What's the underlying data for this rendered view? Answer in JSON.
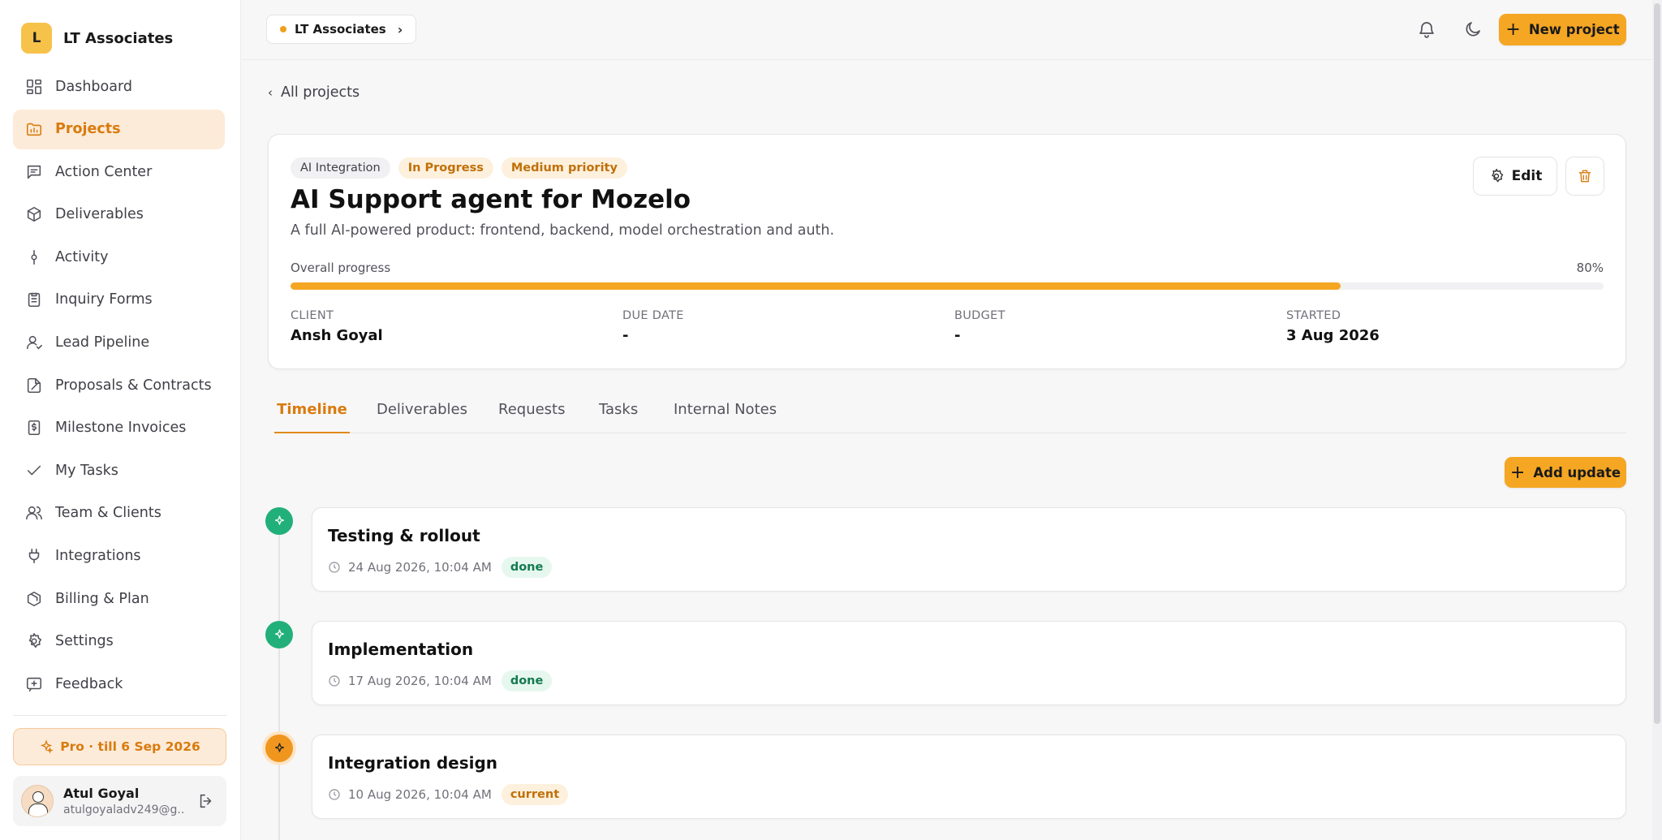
{
  "brand": {
    "logo_letter": "L",
    "name": "LT Associates"
  },
  "sidebar": {
    "items": [
      {
        "label": "Dashboard",
        "icon": "dashboard-icon",
        "active": false
      },
      {
        "label": "Projects",
        "icon": "projects-icon",
        "active": true
      },
      {
        "label": "Action Center",
        "icon": "action-center-icon",
        "active": false
      },
      {
        "label": "Deliverables",
        "icon": "deliverables-icon",
        "active": false
      },
      {
        "label": "Activity",
        "icon": "activity-icon",
        "active": false
      },
      {
        "label": "Inquiry Forms",
        "icon": "clipboard-icon",
        "active": false
      },
      {
        "label": "Lead Pipeline",
        "icon": "lead-icon",
        "active": false
      },
      {
        "label": "Proposals & Contracts",
        "icon": "contract-icon",
        "active": false
      },
      {
        "label": "Milestone Invoices",
        "icon": "invoice-icon",
        "active": false
      },
      {
        "label": "My Tasks",
        "icon": "check-icon",
        "active": false
      },
      {
        "label": "Team & Clients",
        "icon": "users-icon",
        "active": false
      },
      {
        "label": "Integrations",
        "icon": "plug-icon",
        "active": false
      },
      {
        "label": "Billing & Plan",
        "icon": "billing-icon",
        "active": false
      },
      {
        "label": "Settings",
        "icon": "gear-icon",
        "active": false
      },
      {
        "label": "Feedback",
        "icon": "feedback-icon",
        "active": false
      }
    ],
    "plan_label": "Pro · till 6 Sep 2026",
    "user": {
      "name": "Atul Goyal",
      "email": "atulgoyaladv249@g..."
    }
  },
  "topbar": {
    "workspace": "LT Associates",
    "new_project_label": "New project"
  },
  "main": {
    "back_label": "All projects",
    "project": {
      "tags": [
        {
          "label": "AI Integration",
          "style": "gray"
        },
        {
          "label": "In Progress",
          "style": "orange"
        },
        {
          "label": "Medium priority",
          "style": "orange"
        }
      ],
      "title": "AI Support agent for Mozelo",
      "description": "A full AI-powered product: frontend, backend, model orchestration and auth.",
      "edit_label": "Edit",
      "progress_label": "Overall progress",
      "progress_percent": 80,
      "progress_text": "80%",
      "meta": [
        {
          "label": "CLIENT",
          "value": "Ansh Goyal"
        },
        {
          "label": "DUE DATE",
          "value": "-"
        },
        {
          "label": "BUDGET",
          "value": "-"
        },
        {
          "label": "STARTED",
          "value": "3 Aug 2026"
        }
      ]
    },
    "tabs": [
      {
        "label": "Timeline",
        "active": true
      },
      {
        "label": "Deliverables",
        "active": false
      },
      {
        "label": "Requests",
        "active": false
      },
      {
        "label": "Tasks",
        "active": false
      },
      {
        "label": "Internal Notes",
        "active": false
      }
    ],
    "add_update_label": "Add update",
    "timeline": [
      {
        "title": "Testing & rollout",
        "time": "24 Aug 2026, 10:04 AM",
        "status": "done"
      },
      {
        "title": "Implementation",
        "time": "17 Aug 2026, 10:04 AM",
        "status": "done"
      },
      {
        "title": "Integration design",
        "time": "10 Aug 2026, 10:04 AM",
        "status": "current"
      }
    ]
  },
  "colors": {
    "accent": "#f5a623",
    "accent_text": "#d97b0e",
    "done": "#22b07a"
  }
}
